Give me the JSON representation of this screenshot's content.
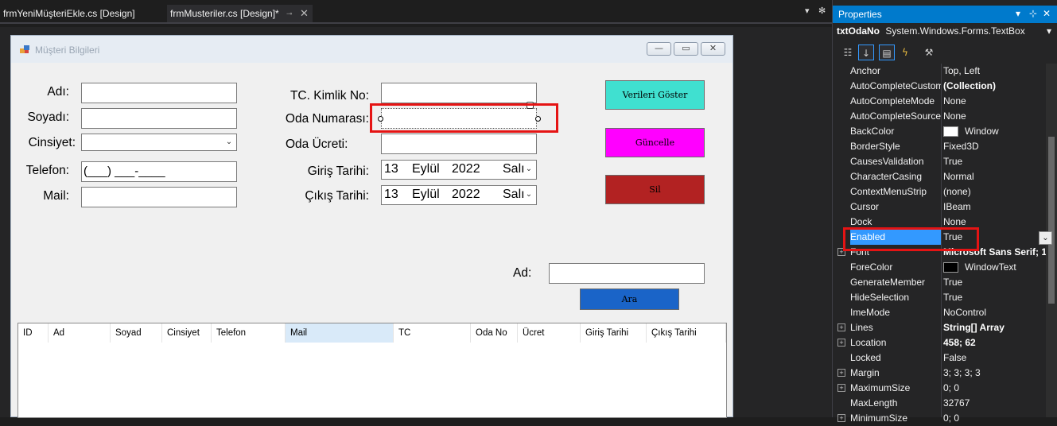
{
  "tabs": [
    {
      "label": "frmYeniMüşteriEkle.cs [Design]",
      "active": false
    },
    {
      "label": "frmMusteriler.cs [Design]*",
      "active": true
    }
  ],
  "tab_pin": "⊸",
  "tab_close": "✕",
  "strip_buttons": {
    "dropdown": "▾",
    "settings": "✻"
  },
  "form": {
    "title": "Müşteri Bilgileri",
    "window_buttons": {
      "minimize": "—",
      "maximize": "▭",
      "close": "✕"
    },
    "labels": {
      "ad": "Adı:",
      "soyad": "Soyadı:",
      "cinsiyet": "Cinsiyet:",
      "telefon": "Telefon:",
      "mail": "Mail:",
      "tc": "TC. Kimlik No:",
      "oda_no": "Oda Numarası:",
      "oda_ucret": "Oda Ücreti:",
      "giris": "Giriş Tarihi:",
      "cikis": "Çıkış Tarihi:",
      "ara_ad": "Ad:"
    },
    "telefon_mask": "(___) ___-____",
    "giris_date": {
      "day": "13",
      "month": "Eylül",
      "year": "2022",
      "weekday": "Salı"
    },
    "cikis_date": {
      "day": "13",
      "month": "Eylül",
      "year": "2022",
      "weekday": "Salı"
    },
    "buttons": {
      "verileri_goster": "Verileri Göster",
      "guncelle": "Güncelle",
      "sil": "Sil",
      "ara": "Ara"
    },
    "grid_columns": [
      "ID",
      "Ad",
      "Soyad",
      "Cinsiyet",
      "Telefon",
      "Mail",
      "TC",
      "Oda No",
      "Ücret",
      "Giriş Tarihi",
      "Çıkış Tarihi"
    ]
  },
  "properties": {
    "title": "Properties",
    "title_buttons": {
      "dropdown": "▾",
      "pin": "⊹",
      "close": "✕"
    },
    "object_name": "txtOdaNo",
    "object_type": "System.Windows.Forms.TextBox",
    "object_dropdown": "▾",
    "toolbar_icons": [
      "categorized-icon",
      "alphabetical-icon",
      "properties-icon",
      "events-icon",
      "property-pages-icon"
    ],
    "rows": [
      {
        "name": "Anchor",
        "value": "Top, Left"
      },
      {
        "name": "AutoCompleteCustomSource",
        "value": "(Collection)",
        "bold": true
      },
      {
        "name": "AutoCompleteMode",
        "value": "None"
      },
      {
        "name": "AutoCompleteSource",
        "value": "None"
      },
      {
        "name": "BackColor",
        "value": "Window",
        "swatch": "#ffffff"
      },
      {
        "name": "BorderStyle",
        "value": "Fixed3D"
      },
      {
        "name": "CausesValidation",
        "value": "True"
      },
      {
        "name": "CharacterCasing",
        "value": "Normal"
      },
      {
        "name": "ContextMenuStrip",
        "value": "(none)"
      },
      {
        "name": "Cursor",
        "value": "IBeam"
      },
      {
        "name": "Dock",
        "value": "None"
      },
      {
        "name": "Enabled",
        "value": "True",
        "selected": true
      },
      {
        "name": "Font",
        "value": "Microsoft Sans Serif; 1",
        "bold": true,
        "expand": true
      },
      {
        "name": "ForeColor",
        "value": "WindowText",
        "swatch": "#000000"
      },
      {
        "name": "GenerateMember",
        "value": "True"
      },
      {
        "name": "HideSelection",
        "value": "True"
      },
      {
        "name": "ImeMode",
        "value": "NoControl"
      },
      {
        "name": "Lines",
        "value": "String[] Array",
        "bold": true,
        "expand": true
      },
      {
        "name": "Location",
        "value": "458; 62",
        "bold": true,
        "expand": true
      },
      {
        "name": "Locked",
        "value": "False"
      },
      {
        "name": "Margin",
        "value": "3; 3; 3; 3",
        "expand": true
      },
      {
        "name": "MaximumSize",
        "value": "0; 0",
        "expand": true
      },
      {
        "name": "MaxLength",
        "value": "32767"
      },
      {
        "name": "MinimumSize",
        "value": "0; 0",
        "expand": true
      }
    ],
    "expand_glyph": "+",
    "enabled_dropdown": "⌄"
  },
  "colors": {
    "btn_verileri": "#40e0d0",
    "btn_guncelle": "#ff00ff",
    "btn_sil": "#b22222",
    "btn_ara": "#1a64c8",
    "highlight": "#e51414",
    "accent": "#007acc"
  }
}
